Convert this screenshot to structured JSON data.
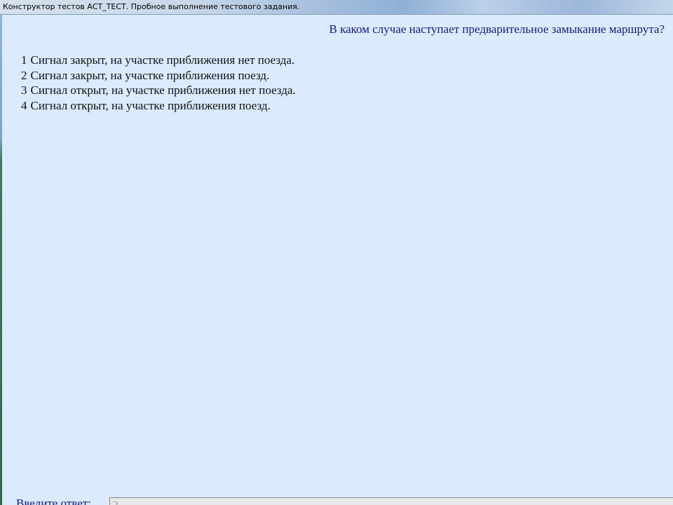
{
  "window": {
    "title": "Конструктор тестов АСТ_ТЕСТ. Пробное выполнение тестового задания."
  },
  "question": {
    "text": "В каком случае наступает предварительное замыкание маршрута?"
  },
  "answers": [
    {
      "number": "1",
      "label": "Сигнал закрыт, на участке приближения нет поезда."
    },
    {
      "number": "2",
      "label": "Сигнал закрыт, на участке приближения поезд."
    },
    {
      "number": "3",
      "label": "Сигнал открыт, на участке приближения нет поезда."
    },
    {
      "number": "4",
      "label": "Сигнал открыт, на участке приближения поезд."
    }
  ],
  "answer_input": {
    "label": "Введите ответ:",
    "value": "",
    "placeholder": "?"
  },
  "colors": {
    "background": "#dbeafc",
    "question_text": "#1a1a7a",
    "answer_text": "#111111"
  }
}
